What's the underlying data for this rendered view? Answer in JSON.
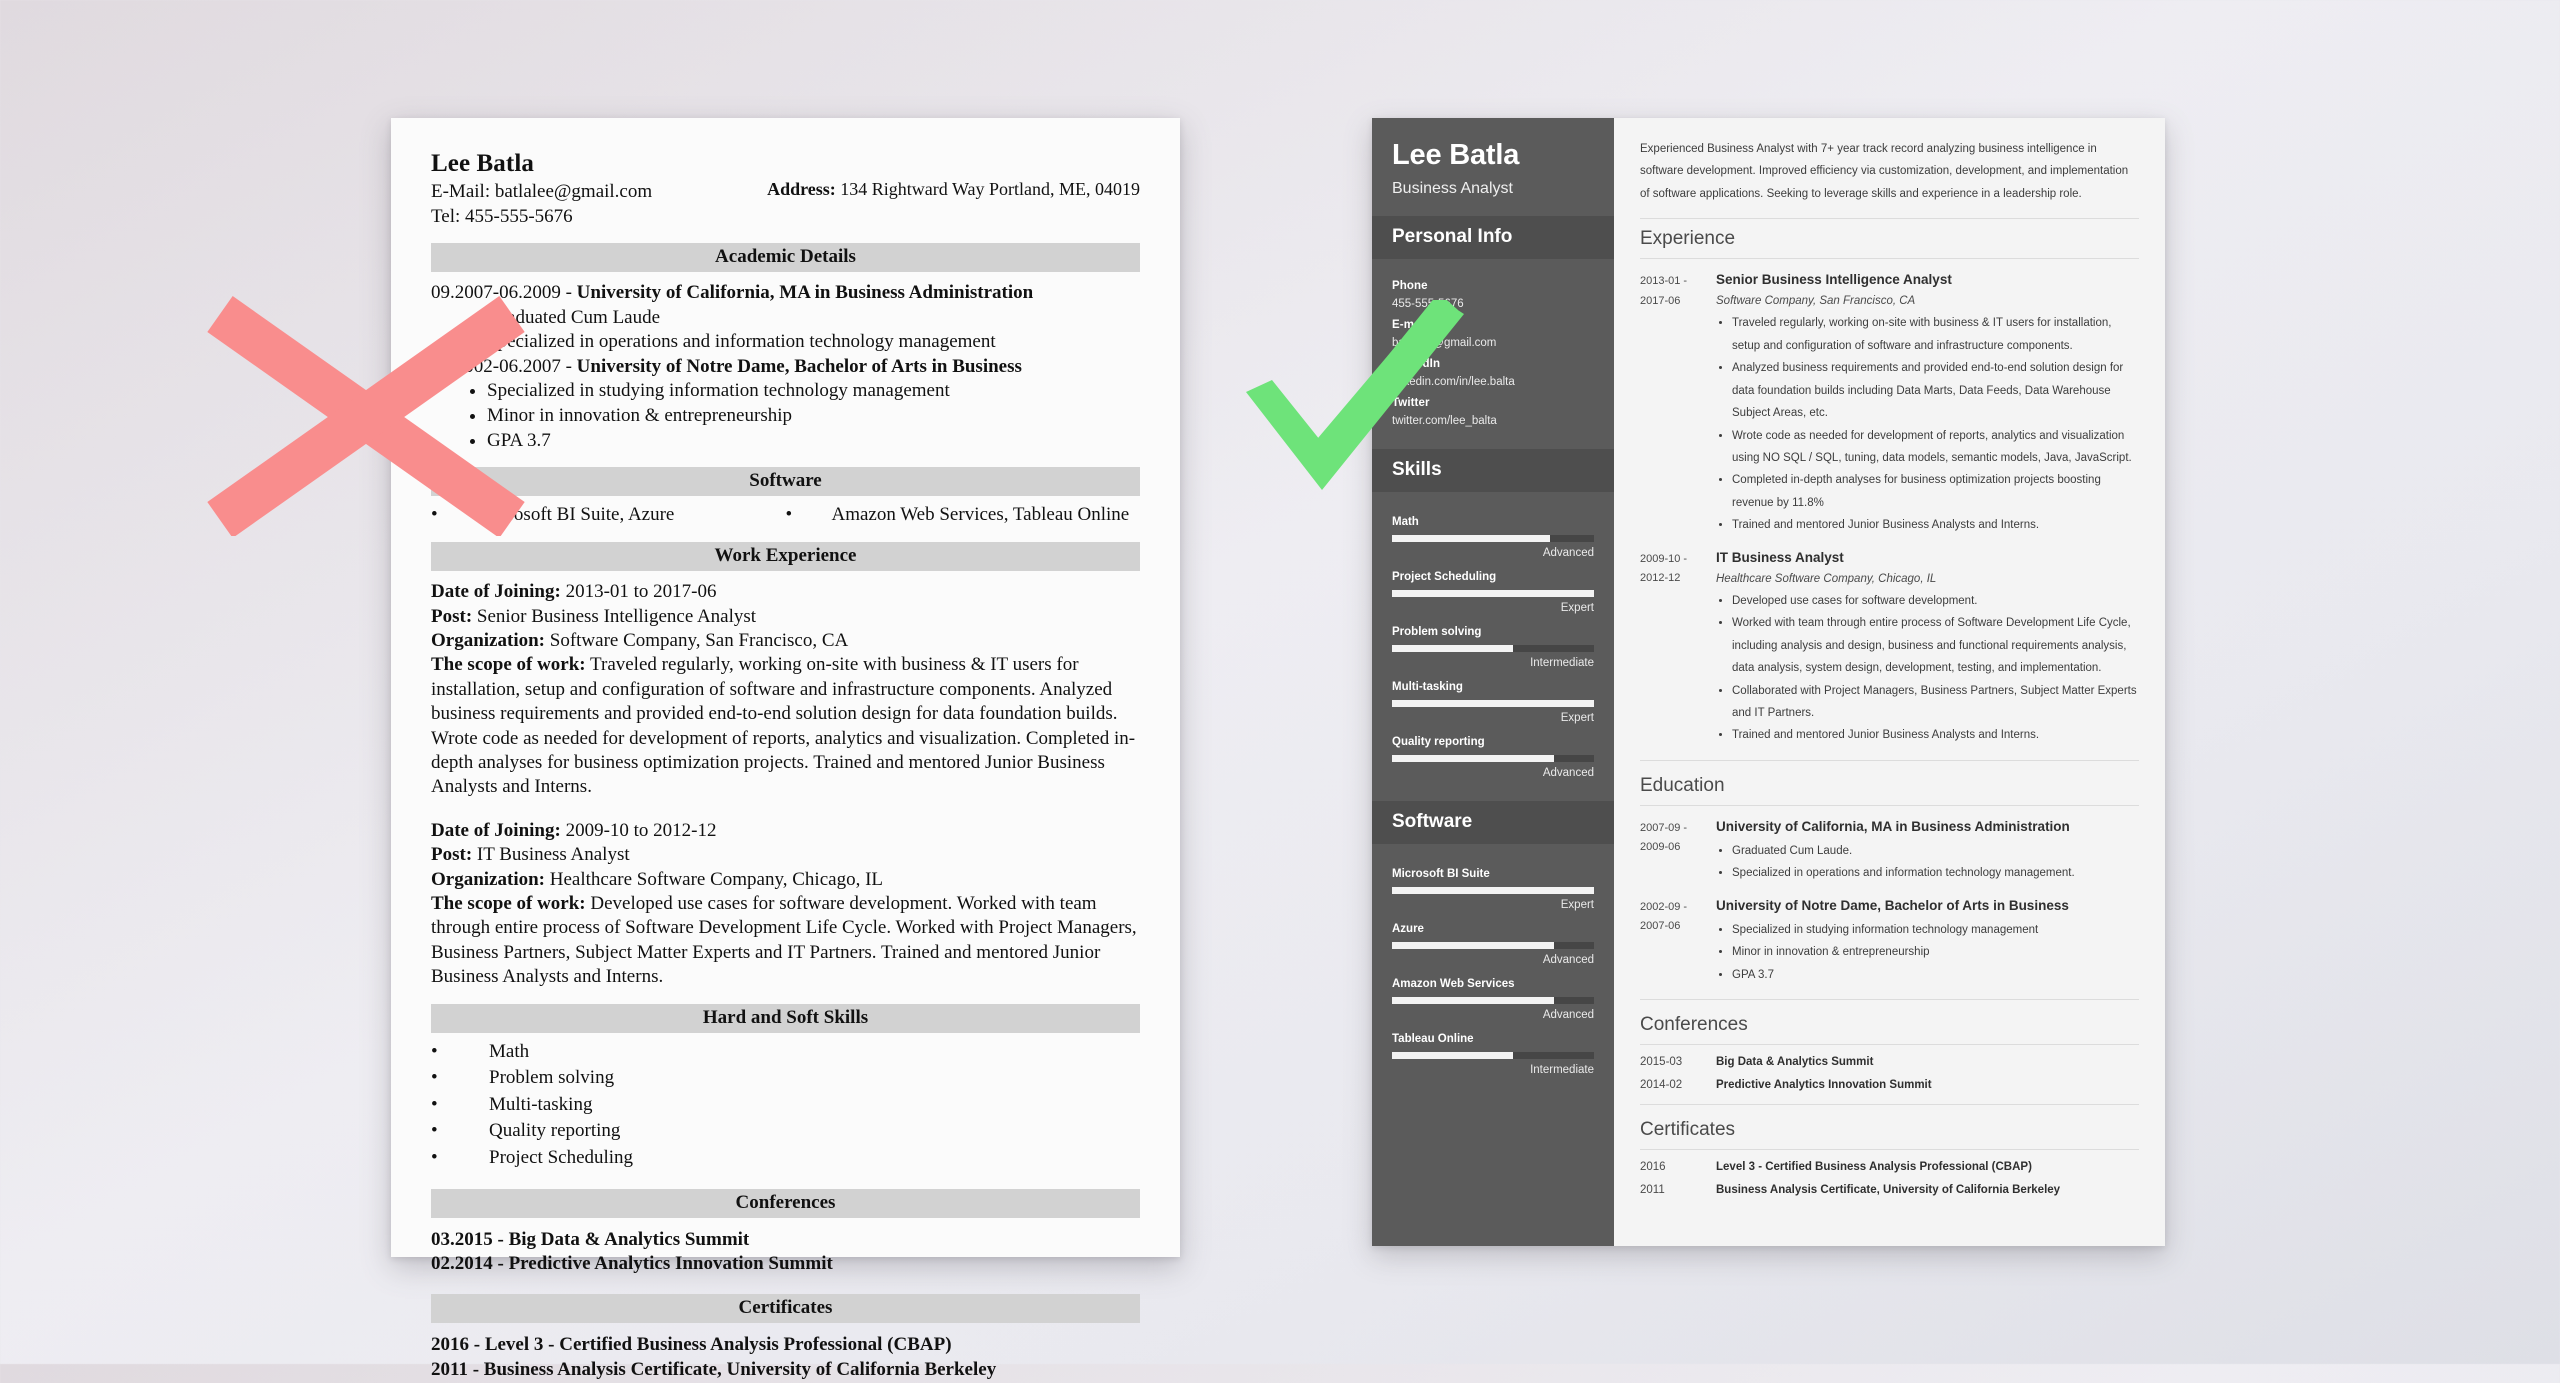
{
  "marks": {
    "reject_icon": "red-x-mark",
    "approve_icon": "green-check-mark",
    "reject_color": "#f98d8d",
    "approve_color": "#6ee37a"
  },
  "bad_resume": {
    "name": "Lee Batla",
    "email_line": "E-Mail: batlalee@gmail.com",
    "tel_line": "Tel: 455-555-5676",
    "address_label": "Address:",
    "address_value": "134 Rightward Way Portland, ME, 04019",
    "sections": {
      "academic": "Academic Details",
      "software": "Software",
      "work": "Work Experience",
      "skills": "Hard and Soft Skills",
      "conferences": "Conferences",
      "certificates": "Certificates"
    },
    "academic": [
      {
        "dates": "09.2007-06.2009 - ",
        "school": "University of California, MA in Business Administration",
        "bullets": [
          "Graduated Cum Laude",
          "Specialized in operations and information technology management"
        ]
      },
      {
        "dates": "09.2002-06.2007 - ",
        "school": "University of Notre Dame, Bachelor of Arts in Business",
        "bullets": [
          "Specialized in studying information technology management",
          "Minor in innovation & entrepreneurship",
          "GPA 3.7"
        ]
      }
    ],
    "software_left": "Microsoft BI Suite, Azure",
    "software_right": "Amazon Web Services, Tableau Online",
    "work": [
      {
        "date_label": "Date of Joining:",
        "date_value": " 2013-01 to 2017-06",
        "post_label": "Post:",
        "post_value": " Senior Business Intelligence Analyst",
        "org_label": "Organization:",
        "org_value": " Software Company, San Francisco, CA",
        "scope_label": "The scope of work:",
        "scope_value": " Traveled regularly, working on-site with business & IT users for installation, setup and configuration of software and infrastructure components. Analyzed business requirements and provided end-to-end solution design for data foundation builds. Wrote code as needed for development of reports, analytics and visualization. Completed in-depth analyses for business optimization projects. Trained and mentored Junior Business Analysts and Interns."
      },
      {
        "date_label": "Date of Joining:",
        "date_value": " 2009-10 to 2012-12",
        "post_label": "Post:",
        "post_value": " IT Business Analyst",
        "org_label": "Organization:",
        "org_value": " Healthcare Software Company, Chicago, IL",
        "scope_label": "The scope of work:",
        "scope_value": " Developed use cases for software development. Worked with team through entire process of Software Development Life Cycle. Worked with Project Managers, Business Partners, Subject Matter Experts and IT Partners. Trained and mentored Junior Business Analysts and Interns."
      }
    ],
    "skills": [
      "Math",
      "Problem solving",
      "Multi-tasking",
      "Quality reporting",
      "Project Scheduling"
    ],
    "conferences": [
      "03.2015 - Big Data & Analytics Summit",
      "02.2014 - Predictive Analytics Innovation Summit"
    ],
    "certificates": [
      "2016 - Level 3 - Certified Business Analysis Professional (CBAP)",
      "2011 - Business Analysis Certificate, University of California Berkeley"
    ]
  },
  "good_resume": {
    "name": "Lee Batla",
    "role": "Business Analyst",
    "sidebar": {
      "personal_info_heading": "Personal Info",
      "contacts": [
        {
          "label": "Phone",
          "value": "455-555-5676"
        },
        {
          "label": "E-mail",
          "value": "batlalee@gmail.com"
        },
        {
          "label": "LinkedIn",
          "value": "linkedin.com/in/lee.balta"
        },
        {
          "label": "Twitter",
          "value": "twitter.com/lee_balta"
        }
      ],
      "skills_heading": "Skills",
      "skills": [
        {
          "name": "Math",
          "level": "Advanced",
          "pct": 78
        },
        {
          "name": "Project Scheduling",
          "level": "Expert",
          "pct": 100
        },
        {
          "name": "Problem solving",
          "level": "Intermediate",
          "pct": 60
        },
        {
          "name": "Multi-tasking",
          "level": "Expert",
          "pct": 100
        },
        {
          "name": "Quality reporting",
          "level": "Advanced",
          "pct": 80
        }
      ],
      "software_heading": "Software",
      "software": [
        {
          "name": "Microsoft BI Suite",
          "level": "Expert",
          "pct": 100
        },
        {
          "name": "Azure",
          "level": "Advanced",
          "pct": 80
        },
        {
          "name": "Amazon Web Services",
          "level": "Advanced",
          "pct": 80
        },
        {
          "name": "Tableau Online",
          "level": "Intermediate",
          "pct": 60
        }
      ]
    },
    "summary": "Experienced Business Analyst with 7+ year track record analyzing business intelligence in software development. Improved efficiency via customization, development, and implementation of software applications. Seeking to leverage skills and experience in a leadership role.",
    "headings": {
      "experience": "Experience",
      "education": "Education",
      "conferences": "Conferences",
      "certificates": "Certificates"
    },
    "experience": [
      {
        "date_from": "2013-01 -",
        "date_to": "2017-06",
        "title": "Senior Business Intelligence Analyst",
        "org": "Software Company, San Francisco, CA",
        "bullets": [
          "Traveled regularly, working on-site with business & IT users for installation, setup and configuration of software and infrastructure components.",
          "Analyzed business requirements and provided end-to-end solution design for data foundation builds including Data Marts, Data Feeds, Data Warehouse Subject Areas, etc.",
          "Wrote code as needed for development of reports, analytics and visualization using NO SQL / SQL, tuning, data models, semantic models, Java, JavaScript.",
          "Completed in-depth analyses for business optimization projects boosting revenue by 11.8%",
          "Trained and mentored Junior Business Analysts and Interns."
        ]
      },
      {
        "date_from": "2009-10 -",
        "date_to": "2012-12",
        "title": "IT Business Analyst",
        "org": "Healthcare Software Company, Chicago, IL",
        "bullets": [
          "Developed use cases for software development.",
          "Worked with team through entire process of Software Development Life Cycle, including analysis and design, business and functional requirements analysis, data analysis, system design, development, testing, and implementation.",
          "Collaborated with Project Managers, Business Partners, Subject Matter Experts and IT Partners.",
          "Trained and mentored Junior Business Analysts and Interns."
        ]
      }
    ],
    "education": [
      {
        "date_from": "2007-09 -",
        "date_to": "2009-06",
        "title": "University of California, MA in Business Administration",
        "bullets": [
          "Graduated Cum Laude.",
          "Specialized in operations and information technology management."
        ]
      },
      {
        "date_from": "2002-09 -",
        "date_to": "2007-06",
        "title": "University of Notre Dame, Bachelor of Arts in Business",
        "bullets": [
          "Specialized in studying information technology management",
          "Minor in innovation & entrepreneurship",
          "GPA 3.7"
        ]
      }
    ],
    "conferences": [
      {
        "date": "2015-03",
        "title": "Big Data & Analytics Summit"
      },
      {
        "date": "2014-02",
        "title": "Predictive Analytics Innovation Summit"
      }
    ],
    "certificates": [
      {
        "date": "2016",
        "title": "Level 3 - Certified Business Analysis Professional (CBAP)"
      },
      {
        "date": "2011",
        "title": "Business Analysis Certificate, University of California Berkeley"
      }
    ]
  }
}
